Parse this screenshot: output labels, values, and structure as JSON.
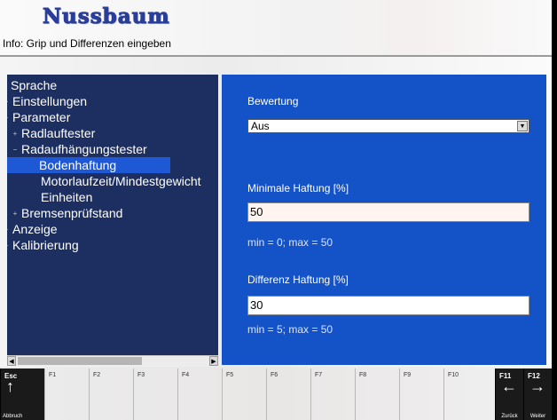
{
  "header": {
    "logo": "Nussbaum",
    "info": "Info: Grip und Differenzen eingeben"
  },
  "tree": [
    {
      "label": "Sprache",
      "level": 0,
      "expander": ""
    },
    {
      "label": "Einstellungen",
      "level": 0,
      "expander": "+"
    },
    {
      "label": "Parameter",
      "level": 0,
      "expander": "−"
    },
    {
      "label": "Radlauftester",
      "level": 1,
      "expander": "+"
    },
    {
      "label": "Radaufhängungstester",
      "level": 1,
      "expander": "−"
    },
    {
      "label": "Bodenhaftung",
      "level": 2,
      "expander": "",
      "selected": true
    },
    {
      "label": "Motorlaufzeit/Mindestgewicht",
      "level": 2,
      "expander": ""
    },
    {
      "label": "Einheiten",
      "level": 2,
      "expander": ""
    },
    {
      "label": "Bremsenprüfstand",
      "level": 1,
      "expander": "+"
    },
    {
      "label": "Anzeige",
      "level": 0,
      "expander": "+"
    },
    {
      "label": "Kalibrierung",
      "level": 0,
      "expander": "+"
    }
  ],
  "form": {
    "rating_label": "Bewertung",
    "rating_value": "Aus",
    "min_label": "Minimale Haftung [%]",
    "min_value": "50",
    "min_hint": "min = 0; max = 50",
    "diff_label": "Differenz Haftung [%]",
    "diff_value": "30",
    "diff_hint": "min = 5; max = 50"
  },
  "fkeys": [
    {
      "key": "Esc",
      "icon": "arrow-up-icon",
      "caption": "Abbruch",
      "dark": true
    },
    {
      "key": "F1",
      "caption": ""
    },
    {
      "key": "F2",
      "caption": ""
    },
    {
      "key": "F3",
      "caption": ""
    },
    {
      "key": "F4",
      "caption": ""
    },
    {
      "key": "F5",
      "caption": ""
    },
    {
      "key": "F6",
      "caption": ""
    },
    {
      "key": "F7",
      "caption": ""
    },
    {
      "key": "F8",
      "caption": ""
    },
    {
      "key": "F9",
      "caption": ""
    },
    {
      "key": "F10",
      "caption": ""
    },
    {
      "key": "F11",
      "icon": "arrow-left-icon",
      "caption": "Zurück",
      "dark": true
    },
    {
      "key": "F12",
      "icon": "arrow-right-icon",
      "caption": "Weiter",
      "dark": true
    }
  ],
  "colors": {
    "panel": "#1452c7",
    "tree_bg": "#1c2f60",
    "selection": "#1e58d4",
    "logo": "#2a3e97"
  }
}
